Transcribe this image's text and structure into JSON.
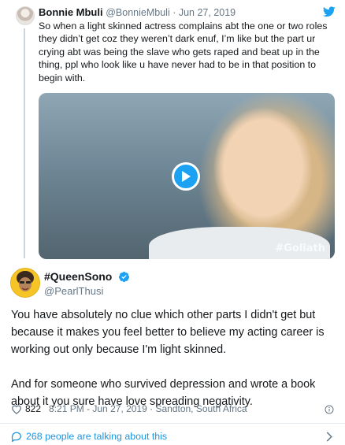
{
  "quoted_tweet": {
    "name": "Bonnie Mbuli",
    "handle": "@BonnieMbuli",
    "date": "Jun 27, 2019",
    "text": "So when a light skinned actress complains abt the one or two roles they didn’t get coz they weren’t dark enuf, I’m like but the part ur crying abt was being the slave who gets raped and beat up in the thing, ppl who look like u have never had to be in that position to begin with.",
    "media_watermark": "#Goliath"
  },
  "reply_tweet": {
    "name": "#QueenSono",
    "handle": "@PearlThusi",
    "paragraphs": [
      "You have absolutely no clue which other parts I didn't get but because it makes you feel better to believe my acting career is working out only because I'm light skinned.",
      "And for someone who survived depression and wrote a book about it you sure have love spreading negativity."
    ],
    "likes": "822",
    "time": "8:21 PM - Jun 27, 2019",
    "location": "Sandton, South Africa"
  },
  "footer": {
    "talking": "268 people are talking about this"
  },
  "colors": {
    "accent": "#1da1f2",
    "link": "#1b95e0",
    "muted": "#657786"
  }
}
